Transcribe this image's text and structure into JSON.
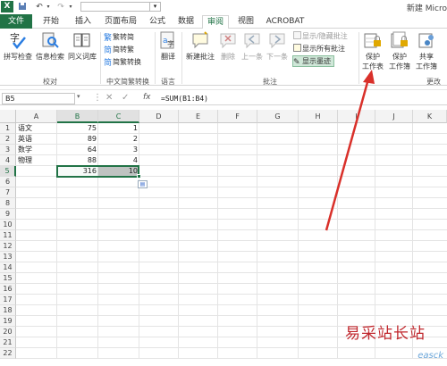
{
  "window": {
    "app_logo": "X",
    "doc_title": "新建 Micro"
  },
  "tabs": {
    "file": "文件",
    "items": [
      "开始",
      "插入",
      "页面布局",
      "公式",
      "数据",
      "审阅",
      "视图",
      "ACROBAT"
    ],
    "active": "审阅"
  },
  "ribbon": {
    "proofing": {
      "spell_check": "拼写检查",
      "research": "信息检索",
      "thesaurus": "同义词库",
      "group_label": "校对"
    },
    "chinese": {
      "to_simplified": "繁转简",
      "to_traditional": "简转繁",
      "convert": "简繁转换",
      "group_label": "中文简繁转换"
    },
    "language": {
      "translate": "翻译",
      "group_label": "语言"
    },
    "comments": {
      "new_comment": "新建批注",
      "delete": "删除",
      "previous": "上一条",
      "next": "下一条",
      "show_hide": "显示/隐藏批注",
      "show_all": "显示所有批注",
      "show_ink": "显示墨迹",
      "group_label": "批注"
    },
    "changes": {
      "protect_sheet_1": "保护",
      "protect_sheet_2": "工作表",
      "protect_book_1": "保护",
      "protect_book_2": "工作簿",
      "share_book_1": "共享",
      "share_book_2": "工作簿",
      "group_label": "更改"
    }
  },
  "formula_bar": {
    "name_box": "B5",
    "fx": "fx",
    "formula": "=SUM(B1:B4)"
  },
  "sheet": {
    "columns": [
      "A",
      "B",
      "C",
      "D",
      "E",
      "F",
      "G",
      "H",
      "I",
      "J",
      "K"
    ],
    "rows": [
      "1",
      "2",
      "3",
      "4",
      "5",
      "6",
      "7",
      "8",
      "9",
      "10",
      "11",
      "12",
      "13",
      "14",
      "15",
      "16",
      "17",
      "18",
      "19",
      "20",
      "21",
      "22"
    ],
    "data": [
      {
        "a": "语文",
        "b": "75",
        "c": "1"
      },
      {
        "a": "英语",
        "b": "89",
        "c": "2"
      },
      {
        "a": "数学",
        "b": "64",
        "c": "3"
      },
      {
        "a": "物理",
        "b": "88",
        "c": "4"
      },
      {
        "a": "",
        "b": "316",
        "c": "10"
      }
    ],
    "selected_cell": "B5"
  },
  "watermark": {
    "text": "易采站长站",
    "sub": "easck"
  },
  "colors": {
    "excel_green": "#217346",
    "arrow_red": "#d9302a"
  }
}
